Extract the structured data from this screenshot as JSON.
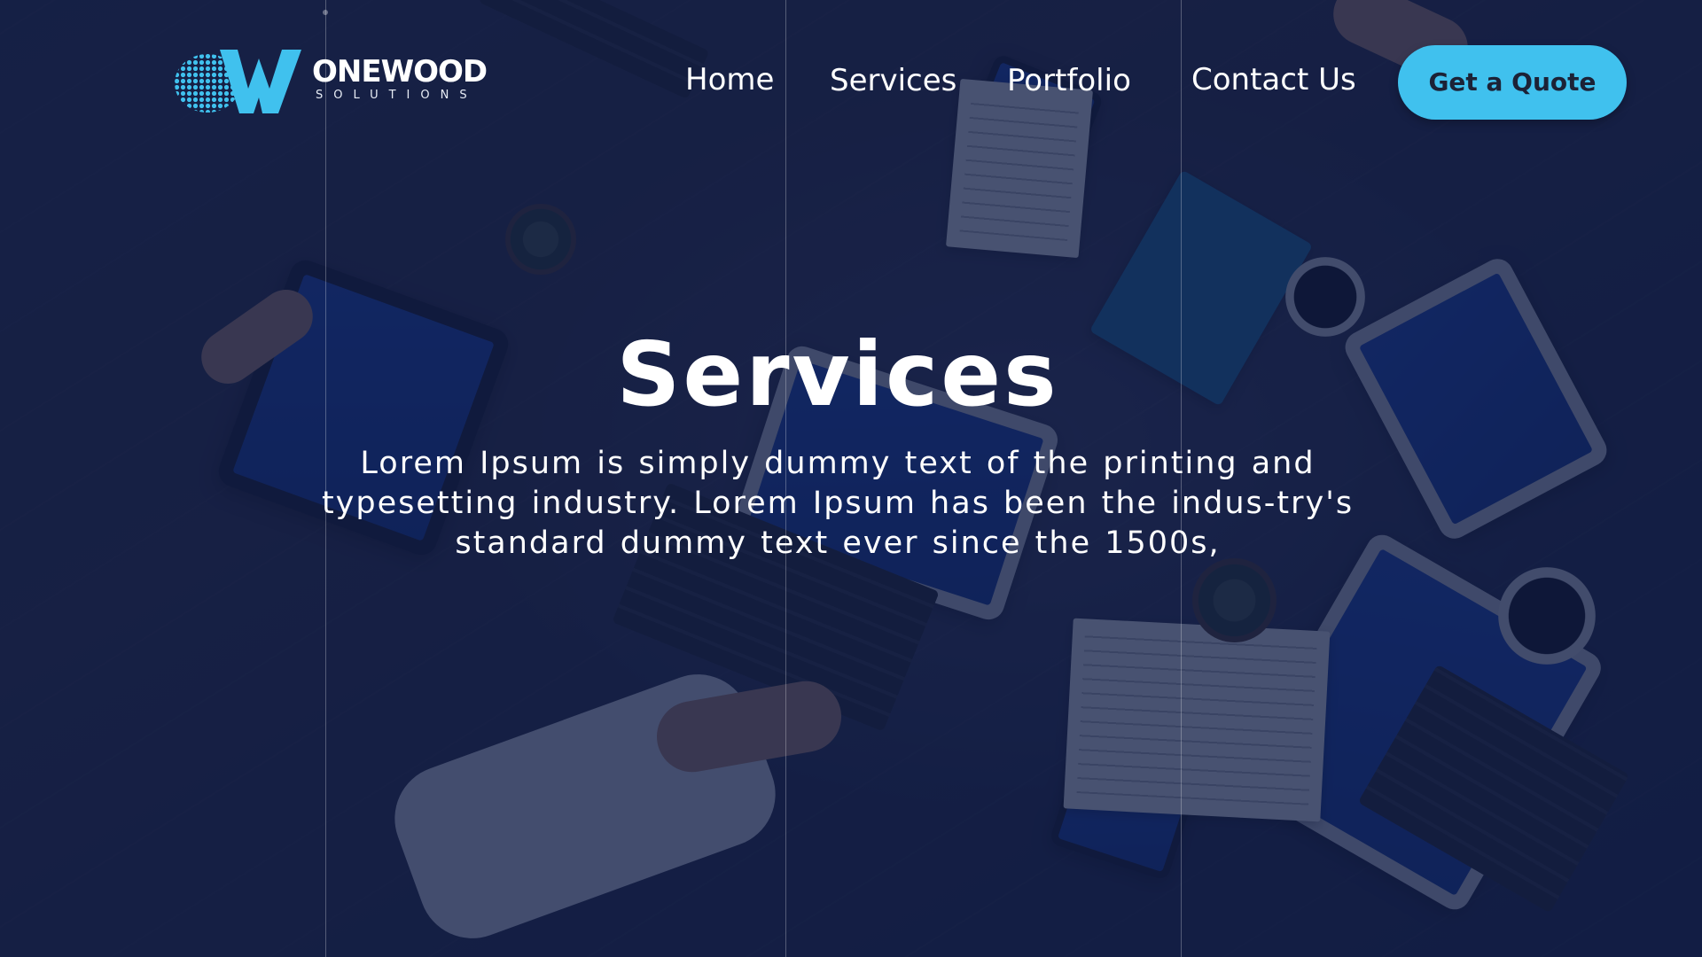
{
  "brand": {
    "name": "ONEWOOD",
    "tagline": "SOLUTIONS",
    "accent_color": "#40c1ee",
    "logo_icon": "globe-w-logo-icon"
  },
  "nav": {
    "items": [
      {
        "label": "Home"
      },
      {
        "label": "Services"
      },
      {
        "label": "Portfolio"
      },
      {
        "label": "Contact Us"
      }
    ],
    "cta_label": "Get a Quote"
  },
  "hero": {
    "title": "Services",
    "text": "Lorem Ipsum is simply dummy text of the printing and typesetting industry. Lorem Ipsum has been the indus-try's standard dummy text ever since the 1500s,",
    "overlay_color": "#0f1b44",
    "background_description": "office-meeting-photo"
  }
}
